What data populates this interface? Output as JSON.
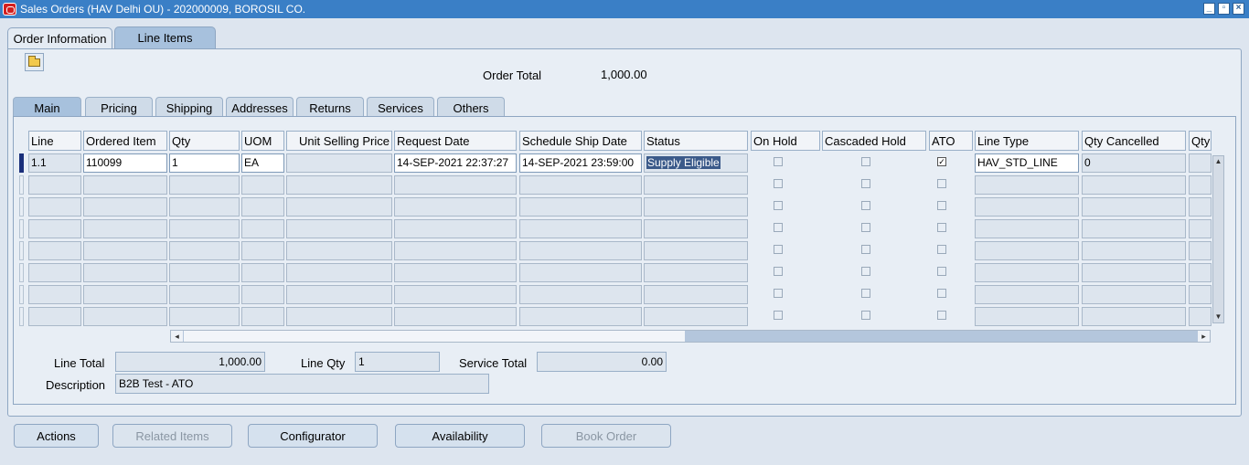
{
  "window": {
    "title": "Sales Orders (HAV Delhi OU) - 202000009, BOROSIL CO."
  },
  "top_tabs": [
    {
      "label": "Order Information",
      "active": false
    },
    {
      "label": "Line Items",
      "active": true
    }
  ],
  "order_total": {
    "label": "Order Total",
    "value": "1,000.00"
  },
  "sub_tabs": [
    {
      "label": "Main",
      "active": true
    },
    {
      "label": "Pricing",
      "active": false
    },
    {
      "label": "Shipping",
      "active": false
    },
    {
      "label": "Addresses",
      "active": false
    },
    {
      "label": "Returns",
      "active": false
    },
    {
      "label": "Services",
      "active": false
    },
    {
      "label": "Others",
      "active": false
    }
  ],
  "grid": {
    "columns": [
      "Line",
      "Ordered Item",
      "Qty",
      "UOM",
      "Unit Selling Price",
      "Request Date",
      "Schedule Ship Date",
      "Status",
      "On Hold",
      "Cascaded Hold",
      "ATO",
      "Line Type",
      "Qty Cancelled",
      "Qty"
    ],
    "rows": [
      {
        "line": "1.1",
        "ordered_item": "110099",
        "qty": "1",
        "uom": "EA",
        "unit_selling_price": "",
        "request_date": "14-SEP-2021 22:37:27",
        "schedule_ship_date": "14-SEP-2021 23:59:00",
        "status": "Supply Eligible",
        "on_hold": false,
        "cascaded_hold": false,
        "ato": true,
        "line_type": "HAV_STD_LINE",
        "qty_cancelled": "0"
      }
    ],
    "empty_rows": 7
  },
  "footer": {
    "line_total_label": "Line Total",
    "line_total_value": "1,000.00",
    "line_qty_label": "Line Qty",
    "line_qty_value": "1",
    "service_total_label": "Service Total",
    "service_total_value": "0.00",
    "description_label": "Description",
    "description_value": "B2B Test - ATO"
  },
  "buttons": [
    {
      "label": "Actions",
      "enabled": true
    },
    {
      "label": "Related Items",
      "enabled": false
    },
    {
      "label": "Configurator",
      "enabled": true
    },
    {
      "label": "Availability",
      "enabled": true
    },
    {
      "label": "Book Order",
      "enabled": false
    }
  ],
  "icons": {
    "app": "oracle-logo-icon",
    "open": "open-folder-icon",
    "minimize": "minimize-icon",
    "restore": "restore-icon",
    "close": "close-icon"
  },
  "colors": {
    "titlebar": "#3a7fc6",
    "selected_status": "#3b5a8a",
    "row_marker": "#1a2f7a"
  }
}
